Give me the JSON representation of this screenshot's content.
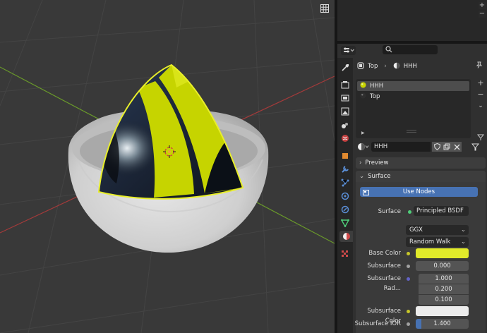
{
  "outliner": {
    "add_label": "+",
    "remove_label": "−"
  },
  "properties": {
    "breadcrumb": {
      "object": "Top",
      "material": "HHH"
    },
    "material_slots": [
      {
        "name": "HHH",
        "selected": true,
        "color": "#c8d400"
      },
      {
        "name": "Top",
        "selected": false,
        "color": "#333333"
      }
    ],
    "slot_add": "+",
    "slot_remove": "−",
    "material_name": "HHH",
    "preview_label": "Preview",
    "surface_panel_label": "Surface",
    "use_nodes_label": "Use Nodes",
    "surface_label": "Surface",
    "surface_shader": "Principled BSDF",
    "distribution": "GGX",
    "subsurface_method": "Random Walk",
    "base_color_label": "Base Color",
    "base_color": "#e1ea2a",
    "subsurface_label": "Subsurface",
    "subsurface_value": "0.000",
    "subsurface_radius_label": "Subsurface Rad...",
    "subsurface_radius": [
      "1.000",
      "0.200",
      "0.100"
    ],
    "subsurface_color_label": "Subsurface Color",
    "subsurface_color": "#ececec",
    "subsurface_ior_label": "Subsurface IOR",
    "subsurface_ior_value": "1.400",
    "subsurface_ior_fill": 0.1
  },
  "icons": {
    "viewport_toggle": "grid-icon",
    "editor_type": "properties-editor-icon",
    "search": "search-icon",
    "pin": "pin-icon"
  },
  "colors": {
    "accent": "#4772b3",
    "selection_outline": "#e8ee2a",
    "x_axis": "#a33a3a",
    "y_axis": "#6a9a2a"
  }
}
